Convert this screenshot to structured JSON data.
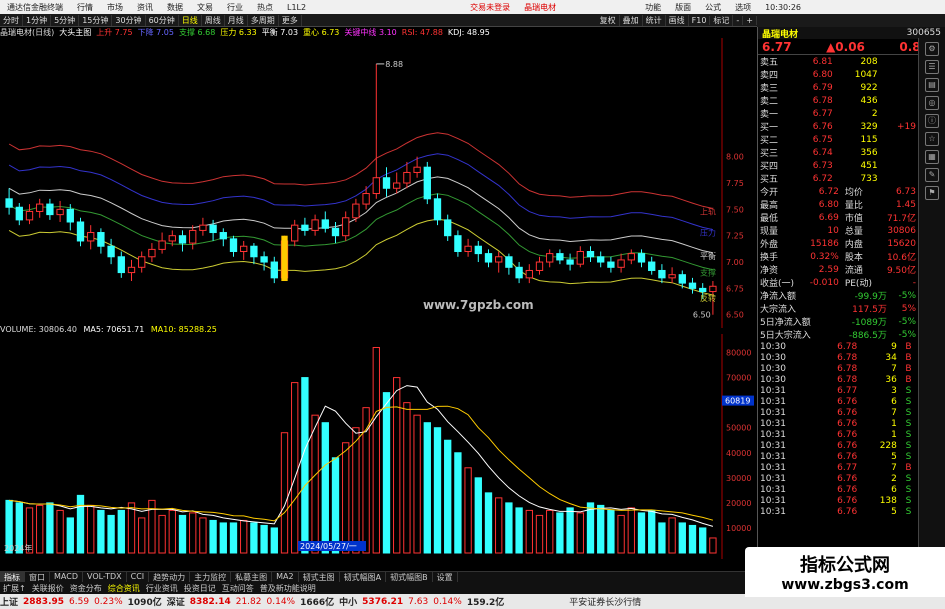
{
  "titlebar": {
    "app": "通达信金融终端",
    "menus": [
      "行情",
      "市场",
      "资讯",
      "数据",
      "文易",
      "行业",
      "热点",
      "L1L2"
    ],
    "notice1": "交易未登录",
    "notice2": "晶瑞电材",
    "right": [
      "功能",
      "版面",
      "公式",
      "选项",
      "10:30:26"
    ]
  },
  "toolbar": {
    "buttons": [
      "分时",
      "1分钟",
      "5分钟",
      "15分钟",
      "30分钟",
      "60分钟",
      "日线",
      "周线",
      "月线",
      "多周期",
      "更多"
    ],
    "right": [
      "复权",
      "叠加",
      "统计",
      "画线",
      "F10",
      "标记",
      "-",
      "+"
    ]
  },
  "status": {
    "title": "晶瑞电材(日线)",
    "indicator": "大头主图",
    "up": "上升 7.75",
    "down": "下降 7.05",
    "stop": "支撑 6.68",
    "pres": "压力 6.33",
    "balance": "平衡 7.03",
    "gravity": "重心 6.73",
    "mid": "关键中线 3.10",
    "rsi": "RSI: 47.88",
    "kdj": "KDJ: 48.95"
  },
  "vol": {
    "label": "VOLUME: 30806.40",
    "ma5": "MA5: 70651.71",
    "ma10": "MA10: 85288.25"
  },
  "price_axis": [
    "8.00",
    "7.75",
    "7.50",
    "7.25",
    "7.00",
    "6.75",
    "6.50"
  ],
  "vol_axis": [
    "80000",
    "70000",
    "60000",
    "50000",
    "40000",
    "30000",
    "20000",
    "10000"
  ],
  "vol_current": "60819",
  "chart_labels": {
    "high": "8.88",
    "low": "6.50",
    "r1": "上轨",
    "r2": "压力",
    "r3": "平衡",
    "r4": "支撑",
    "r5": "反转",
    "date_left": "2024年",
    "date_mid": "2024/05/27/一",
    "url": "www.7gpzb.com"
  },
  "chart_data": {
    "type": "candlestick",
    "candles": [
      [
        7.6,
        7.52,
        7.7,
        7.45
      ],
      [
        7.52,
        7.4,
        7.56,
        7.35
      ],
      [
        7.4,
        7.48,
        7.55,
        7.36
      ],
      [
        7.48,
        7.55,
        7.6,
        7.42
      ],
      [
        7.55,
        7.45,
        7.6,
        7.4
      ],
      [
        7.45,
        7.5,
        7.58,
        7.38
      ],
      [
        7.5,
        7.38,
        7.55,
        7.3
      ],
      [
        7.38,
        7.2,
        7.42,
        7.15
      ],
      [
        7.2,
        7.28,
        7.35,
        7.12
      ],
      [
        7.28,
        7.15,
        7.32,
        7.08
      ],
      [
        7.15,
        7.05,
        7.22,
        6.98
      ],
      [
        7.05,
        6.9,
        7.1,
        6.85
      ],
      [
        6.9,
        6.95,
        7.02,
        6.82
      ],
      [
        6.95,
        7.05,
        7.1,
        6.9
      ],
      [
        7.05,
        7.12,
        7.18,
        7.0
      ],
      [
        7.12,
        7.2,
        7.28,
        7.08
      ],
      [
        7.2,
        7.25,
        7.3,
        7.15
      ],
      [
        7.25,
        7.18,
        7.3,
        7.1
      ],
      [
        7.18,
        7.3,
        7.35,
        7.12
      ],
      [
        7.3,
        7.35,
        7.42,
        7.25
      ],
      [
        7.35,
        7.28,
        7.4,
        7.2
      ],
      [
        7.28,
        7.22,
        7.32,
        7.15
      ],
      [
        7.22,
        7.1,
        7.25,
        7.05
      ],
      [
        7.1,
        7.15,
        7.2,
        7.02
      ],
      [
        7.15,
        7.05,
        7.18,
        6.98
      ],
      [
        7.05,
        7.0,
        7.1,
        6.92
      ],
      [
        7.0,
        6.85,
        7.05,
        6.8
      ],
      [
        6.85,
        7.2,
        7.25,
        6.82
      ],
      [
        7.2,
        7.35,
        7.4,
        7.15
      ],
      [
        7.35,
        7.3,
        7.42,
        7.25
      ],
      [
        7.3,
        7.4,
        7.45,
        7.25
      ],
      [
        7.4,
        7.32,
        7.48,
        7.28
      ],
      [
        7.32,
        7.25,
        7.38,
        7.18
      ],
      [
        7.25,
        7.42,
        7.48,
        7.2
      ],
      [
        7.42,
        7.55,
        7.6,
        7.38
      ],
      [
        7.55,
        7.65,
        7.72,
        7.5
      ],
      [
        7.65,
        7.8,
        8.88,
        7.6
      ],
      [
        7.8,
        7.7,
        7.9,
        7.62
      ],
      [
        7.7,
        7.75,
        7.85,
        7.65
      ],
      [
        7.75,
        7.85,
        7.95,
        7.7
      ],
      [
        7.85,
        7.9,
        8.0,
        7.8
      ],
      [
        7.9,
        7.6,
        7.95,
        7.55
      ],
      [
        7.6,
        7.4,
        7.65,
        7.35
      ],
      [
        7.4,
        7.25,
        7.45,
        7.2
      ],
      [
        7.25,
        7.1,
        7.3,
        7.05
      ],
      [
        7.1,
        7.15,
        7.22,
        7.05
      ],
      [
        7.15,
        7.08,
        7.2,
        7.0
      ],
      [
        7.08,
        7.0,
        7.12,
        6.95
      ],
      [
        7.0,
        7.05,
        7.1,
        6.9
      ],
      [
        7.05,
        6.95,
        7.08,
        6.88
      ],
      [
        6.95,
        6.85,
        7.0,
        6.8
      ],
      [
        6.85,
        6.92,
        6.98,
        6.8
      ],
      [
        6.92,
        7.0,
        7.05,
        6.88
      ],
      [
        7.0,
        7.08,
        7.12,
        6.95
      ],
      [
        7.08,
        7.02,
        7.12,
        6.98
      ],
      [
        7.02,
        6.98,
        7.08,
        6.92
      ],
      [
        6.98,
        7.1,
        7.15,
        6.95
      ],
      [
        7.1,
        7.05,
        7.15,
        7.0
      ],
      [
        7.05,
        7.0,
        7.1,
        6.95
      ],
      [
        7.0,
        6.95,
        7.05,
        6.9
      ],
      [
        6.95,
        7.02,
        7.08,
        6.9
      ],
      [
        7.02,
        7.08,
        7.12,
        6.98
      ],
      [
        7.08,
        7.0,
        7.12,
        6.95
      ],
      [
        7.0,
        6.92,
        7.05,
        6.88
      ],
      [
        6.92,
        6.85,
        6.98,
        6.8
      ],
      [
        6.85,
        6.88,
        6.95,
        6.8
      ],
      [
        6.88,
        6.8,
        6.92,
        6.75
      ],
      [
        6.8,
        6.75,
        6.85,
        6.7
      ],
      [
        6.75,
        6.72,
        6.8,
        6.65
      ],
      [
        6.72,
        6.77,
        6.82,
        6.5
      ]
    ],
    "volume": [
      21000,
      20000,
      18000,
      19000,
      20000,
      17000,
      14000,
      23000,
      19000,
      17000,
      15000,
      17000,
      20000,
      14000,
      21000,
      15000,
      17000,
      15000,
      16000,
      14000,
      13000,
      12000,
      12000,
      13000,
      12000,
      11000,
      10000,
      48000,
      68000,
      70000,
      55000,
      52000,
      38000,
      44000,
      50000,
      58000,
      82000,
      64000,
      70000,
      60000,
      55000,
      52000,
      50000,
      45000,
      40000,
      34000,
      30000,
      24000,
      22000,
      20000,
      18000,
      17000,
      15000,
      17000,
      16000,
      18000,
      16000,
      20000,
      19000,
      17000,
      15000,
      18000,
      16000,
      17000,
      12000,
      14000,
      12000,
      11000,
      10000,
      6000
    ],
    "price_ylim": [
      6.45,
      9.05
    ],
    "vol_ylim": [
      0,
      85000
    ]
  },
  "rightpanel": {
    "name": "晶瑞电材",
    "code": "300655",
    "price": "6.77",
    "change": "▲0.06",
    "pct": "0.89%",
    "asks": [
      {
        "label": "卖五",
        "p": "6.81",
        "v": "208"
      },
      {
        "label": "卖四",
        "p": "6.80",
        "v": "1047"
      },
      {
        "label": "卖三",
        "p": "6.79",
        "v": "922"
      },
      {
        "label": "卖二",
        "p": "6.78",
        "v": "436"
      },
      {
        "label": "卖一",
        "p": "6.77",
        "v": "2"
      }
    ],
    "bids": [
      {
        "label": "买一",
        "p": "6.76",
        "v": "329",
        "x": "+19"
      },
      {
        "label": "买二",
        "p": "6.75",
        "v": "115",
        "x": ""
      },
      {
        "label": "买三",
        "p": "6.74",
        "v": "356",
        "x": ""
      },
      {
        "label": "买四",
        "p": "6.73",
        "v": "451",
        "x": ""
      },
      {
        "label": "买五",
        "p": "6.72",
        "v": "733",
        "x": ""
      }
    ],
    "stats": [
      {
        "a": "今开",
        "b": "6.72",
        "c": "均价",
        "d": "6.73"
      },
      {
        "a": "最高",
        "b": "6.80",
        "c": "量比",
        "d": "1.45"
      },
      {
        "a": "最低",
        "b": "6.69",
        "c": "市值",
        "d": "71.7亿"
      },
      {
        "a": "现量",
        "b": "10",
        "c": "总量",
        "d": "30806"
      },
      {
        "a": "外盘",
        "b": "15186",
        "c": "内盘",
        "d": "15620"
      }
    ],
    "stats2": [
      {
        "a": "换手",
        "b": "0.32%",
        "c": "股本",
        "d": "10.6亿"
      },
      {
        "a": "净资",
        "b": "2.59",
        "c": "流通",
        "d": "9.50亿"
      },
      {
        "a": "收益(一)",
        "b": "-0.010",
        "c": "PE(动)",
        "d": "-"
      }
    ],
    "flows": [
      {
        "a": "净流入额",
        "b": "-99.9万",
        "c": "-5%"
      },
      {
        "a": "大宗流入",
        "b": "117.5万",
        "c": "5%"
      },
      {
        "a": "5日净流入额",
        "b": "-1089万",
        "c": "-5%"
      },
      {
        "a": "5日大宗流入",
        "b": "-886.5万",
        "c": "-5%"
      }
    ],
    "ticks": [
      {
        "t": "10:30",
        "p": "6.78",
        "v": "9",
        "f": "B"
      },
      {
        "t": "10:30",
        "p": "6.78",
        "v": "34",
        "f": "B"
      },
      {
        "t": "10:30",
        "p": "6.78",
        "v": "7",
        "f": "B"
      },
      {
        "t": "10:30",
        "p": "6.78",
        "v": "36",
        "f": "B"
      },
      {
        "t": "10:31",
        "p": "6.77",
        "v": "3",
        "f": "S"
      },
      {
        "t": "10:31",
        "p": "6.76",
        "v": "6",
        "f": "S"
      },
      {
        "t": "10:31",
        "p": "6.76",
        "v": "7",
        "f": "S"
      },
      {
        "t": "10:31",
        "p": "6.76",
        "v": "1",
        "f": "S"
      },
      {
        "t": "10:31",
        "p": "6.76",
        "v": "1",
        "f": "S"
      },
      {
        "t": "10:31",
        "p": "6.76",
        "v": "228",
        "f": "S"
      },
      {
        "t": "10:31",
        "p": "6.76",
        "v": "5",
        "f": "S"
      },
      {
        "t": "10:31",
        "p": "6.77",
        "v": "7",
        "f": "B"
      },
      {
        "t": "10:31",
        "p": "6.76",
        "v": "2",
        "f": "S"
      },
      {
        "t": "10:31",
        "p": "6.76",
        "v": "6",
        "f": "S"
      },
      {
        "t": "10:31",
        "p": "6.76",
        "v": "138",
        "f": "S"
      },
      {
        "t": "10:31",
        "p": "6.76",
        "v": "5",
        "f": "S"
      }
    ]
  },
  "bottomtabs": [
    "指标",
    "窗口",
    "MACD",
    "VOL-TDX",
    "CCI",
    "趋势动力",
    "主力监控",
    "私募主图",
    "MA2",
    "韧式主图",
    "韧式幅图A",
    "韧式幅图B",
    "设置"
  ],
  "bottomtabs2": [
    "扩展↑",
    "关联报价",
    "资金分布",
    "综合资讯",
    "行业资讯",
    "投资日记",
    "互动问答",
    "普及新功能说明"
  ],
  "ticker": [
    {
      "a": "上证",
      "b": "2883.95",
      "c": "6.59",
      "d": "0.23%",
      "e": "1090亿"
    },
    {
      "a": "深证",
      "b": "8382.14",
      "c": "21.82",
      "d": "0.14%",
      "e": "1666亿"
    },
    {
      "a": "中小",
      "b": "5376.21",
      "c": "7.63",
      "d": "0.14%",
      "e": "159.2亿"
    }
  ],
  "ticker_right": "平安证券长沙行情",
  "watermark": {
    "t1": "指标公式网",
    "t2": "www.zbgs3.com"
  }
}
